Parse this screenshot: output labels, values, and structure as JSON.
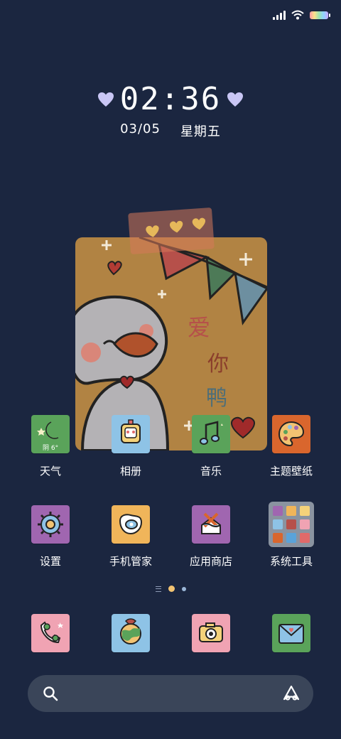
{
  "status_bar": {
    "signal": "signal-icon",
    "wifi": "wifi-icon",
    "battery": "battery-icon"
  },
  "clock": {
    "time": "02:36",
    "date": "03/05",
    "weekday": "星期五"
  },
  "widget": {
    "text": [
      "爱",
      "你",
      "鸭"
    ]
  },
  "weather_tile": {
    "temp": "阴 6°"
  },
  "apps_row1": [
    {
      "label": "天气",
      "icon": "weather-icon",
      "color": "#5aa35a"
    },
    {
      "label": "相册",
      "icon": "photo-frame-icon",
      "color": "#8ec3e6"
    },
    {
      "label": "音乐",
      "icon": "music-note-icon",
      "color": "#5aa35a"
    },
    {
      "label": "主题壁纸",
      "icon": "palette-icon",
      "color": "#d9662d"
    }
  ],
  "apps_row2": [
    {
      "label": "设置",
      "icon": "gear-icon",
      "color": "#a066b0"
    },
    {
      "label": "手机管家",
      "icon": "shield-icon",
      "color": "#f0b55a"
    },
    {
      "label": "应用商店",
      "icon": "store-icon",
      "color": "#a066b0"
    },
    {
      "label": "系统工具",
      "icon": "folder-icon",
      "color": "#8a93a0"
    }
  ],
  "dock": [
    {
      "icon": "phone-icon",
      "color": "#f0a3b3"
    },
    {
      "icon": "browser-icon",
      "color": "#8ec3e6"
    },
    {
      "icon": "camera-icon",
      "color": "#f0a3b3"
    },
    {
      "icon": "message-icon",
      "color": "#5aa35a"
    }
  ],
  "search": {
    "icon": "search-icon",
    "assistant_icon": "assistant-icon"
  }
}
